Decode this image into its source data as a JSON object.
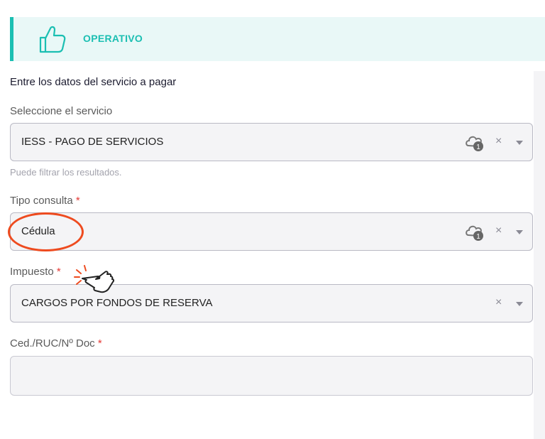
{
  "status": {
    "label": "OPERATIVO",
    "icon": "thumbs-up-icon",
    "accent": "#1bbfb2",
    "background": "#e9f8f7"
  },
  "form": {
    "heading": "Entre los datos del servicio a pagar",
    "service": {
      "label": "Seleccione el servicio",
      "value": "IESS - PAGO DE SERVICIOS",
      "clear": "×",
      "help": "Puede filtrar los resultados."
    },
    "tipo_consulta": {
      "label": "Tipo consulta",
      "required": "*",
      "value": "Cédula",
      "clear": "×"
    },
    "impuesto": {
      "label": "Impuesto",
      "required": "*",
      "value": "CARGOS POR FONDOS DE RESERVA",
      "clear": "×"
    },
    "documento": {
      "label": "Ced./RUC/Nº Doc",
      "required": "*",
      "value": ""
    }
  },
  "colors": {
    "required": "#e53935",
    "annotation": "#ee4b1f",
    "field_bg": "#f4f4f6"
  }
}
